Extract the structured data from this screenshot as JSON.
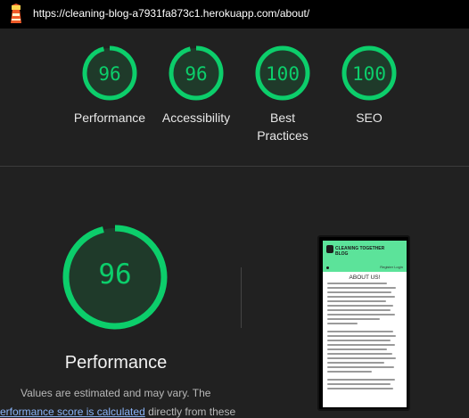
{
  "topbar": {
    "url": "https://cleaning-blog-a7931fa873c1.herokuapp.com/about/",
    "logo_icon": "lighthouse-icon"
  },
  "colors": {
    "pass": "#0cce6b",
    "pass_fill": "#1f3a2a",
    "background": "#212121",
    "link": "#8ab4f8"
  },
  "gauges": [
    {
      "score": "96",
      "label": "Performance"
    },
    {
      "score": "96",
      "label": "Accessibility"
    },
    {
      "score": "100",
      "label": "Best Practices"
    },
    {
      "score": "100",
      "label": "SEO"
    }
  ],
  "performance": {
    "score": "96",
    "title": "Performance",
    "note_line1": "Values are estimated and may vary. The",
    "note_link": "erformance score is calculated",
    "note_line2_rest": " directly from these"
  },
  "thumbnail": {
    "brand": "CLEANING TOGETHER BLOG",
    "login": "Register Login",
    "heading": "ABOUT US!"
  }
}
